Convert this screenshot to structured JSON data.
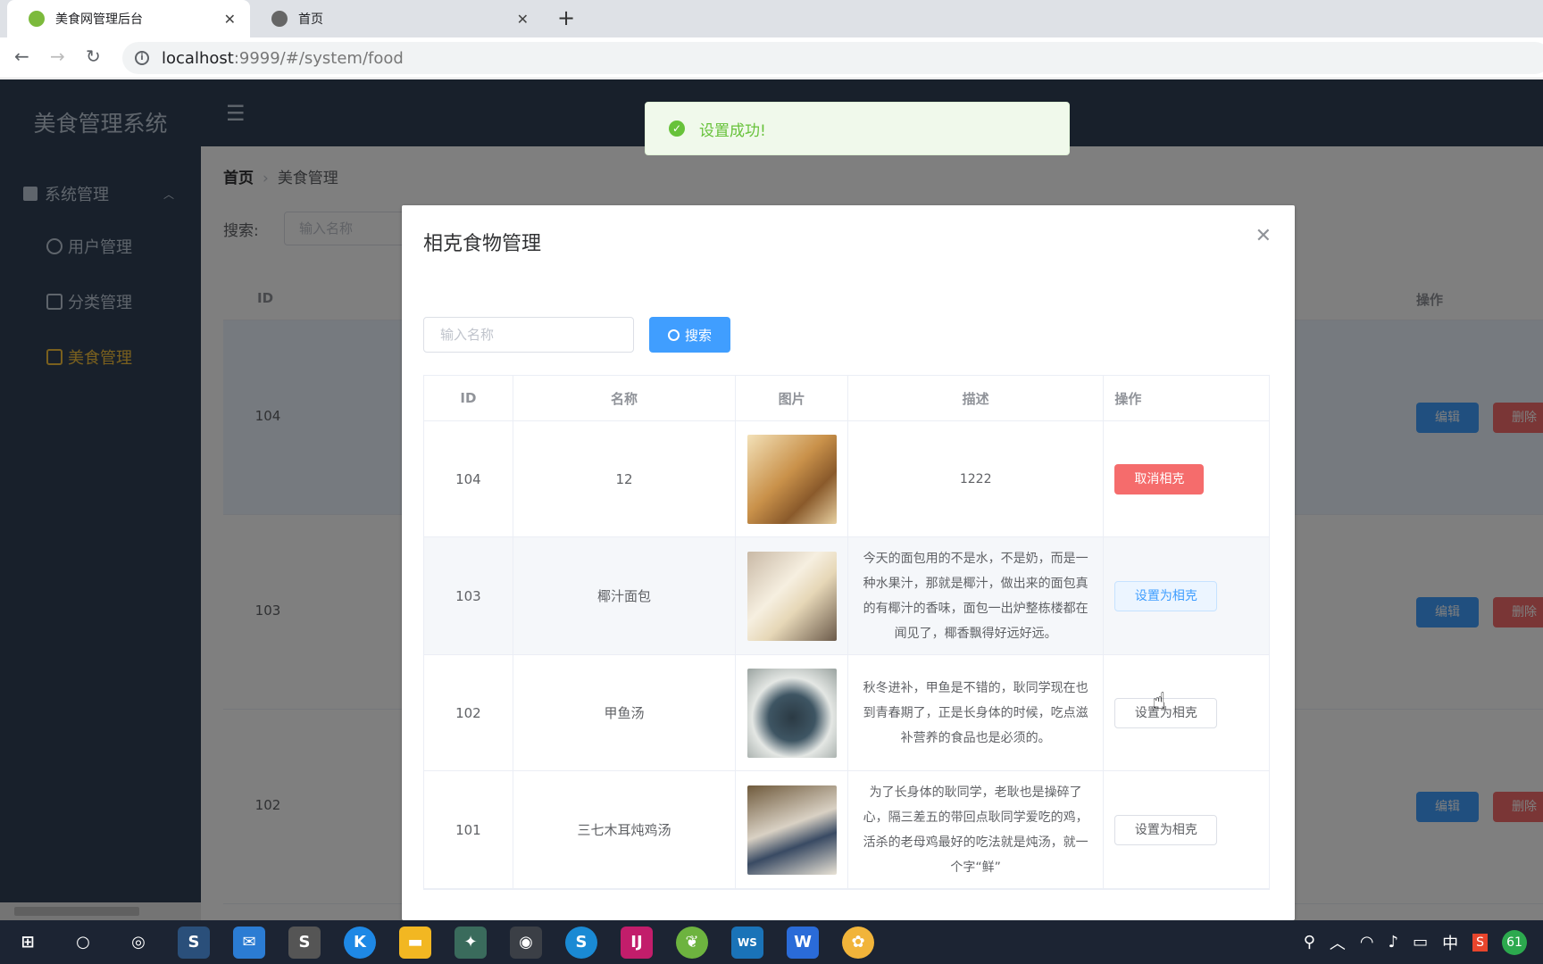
{
  "browser": {
    "tabs": [
      {
        "title": "美食网管理后台",
        "active": true
      },
      {
        "title": "首页",
        "active": false
      }
    ],
    "url_host": "localhost",
    "url_rest": ":9999/#/system/food"
  },
  "sidebar": {
    "brand": "美食管理系统",
    "group": "系统管理",
    "items": [
      {
        "label": "用户管理",
        "active": false
      },
      {
        "label": "分类管理",
        "active": false
      },
      {
        "label": "美食管理",
        "active": true
      }
    ]
  },
  "breadcrumb": {
    "home": "首页",
    "current": "美食管理"
  },
  "search": {
    "label": "搜索:",
    "placeholder": "输入名称"
  },
  "background_table": {
    "headers": {
      "id": "ID",
      "ops": "操作"
    },
    "rows": [
      {
        "id": "104",
        "edit": "编辑",
        "delete": "删除"
      },
      {
        "id": "103",
        "edit": "编辑",
        "delete": "删除"
      },
      {
        "id": "102",
        "edit": "编辑",
        "delete": "删除"
      }
    ]
  },
  "toast": {
    "message": "设置成功!",
    "type": "success",
    "color": "#67c23a"
  },
  "dialog": {
    "title": "相克食物管理",
    "search_placeholder": "输入名称",
    "search_button": "搜索",
    "headers": [
      "ID",
      "名称",
      "图片",
      "描述",
      "操作"
    ],
    "rows": [
      {
        "id": "104",
        "name": "12",
        "image": "bread-roll",
        "desc": "1222",
        "action": "取消相克",
        "action_type": "danger"
      },
      {
        "id": "103",
        "name": "椰汁面包",
        "image": "coconut-bread",
        "desc": "今天的面包用的不是水，不是奶，而是一种水果汁，那就是椰汁，做出来的面包真的有椰汁的香味，面包一出炉整栋楼都在闻见了，椰香飘得好远好远。",
        "action": "设置为相克",
        "action_type": "default-hover"
      },
      {
        "id": "102",
        "name": "甲鱼汤",
        "image": "turtle-soup",
        "desc": "秋冬进补，甲鱼是不错的，耿同学现在也到青春期了，正是长身体的时候，吃点滋补营养的食品也是必须的。",
        "action": "设置为相克",
        "action_type": "default"
      },
      {
        "id": "101",
        "name": "三七木耳炖鸡汤",
        "image": "chicken-soup",
        "desc": "为了长身体的耿同学，老耿也是操碎了心，隔三差五的带回点耿同学爱吃的鸡，活杀的老母鸡最好的吃法就是炖汤，就一个字“鲜”",
        "action": "设置为相克",
        "action_type": "default"
      }
    ]
  },
  "taskbar": {
    "tray_lang": "中",
    "tray_badge": "61"
  },
  "colors": {
    "primary": "#409eff",
    "danger": "#f56c6c",
    "sidebar": "#304156",
    "active_menu": "#f4c13c"
  }
}
